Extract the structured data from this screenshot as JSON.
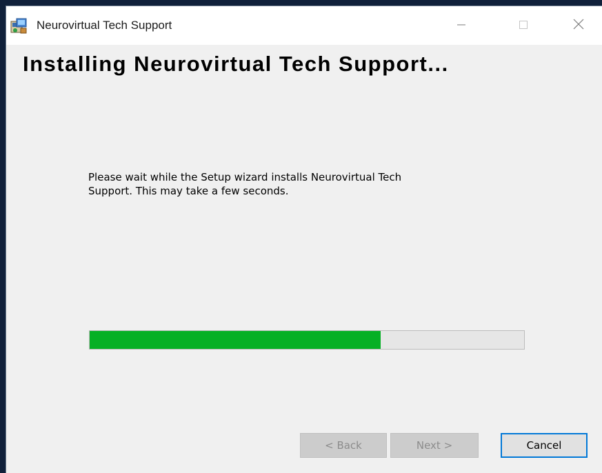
{
  "window": {
    "title": "Neurovirtual Tech Support",
    "app_icon": "installer-icon",
    "controls": {
      "minimize_icon": "minimize-icon",
      "maximize_icon": "maximize-icon",
      "close_icon": "close-icon"
    }
  },
  "header": {
    "title": "Installing Neurovirtual Tech Support..."
  },
  "body": {
    "description_line1": "Please wait while the Setup wizard installs Neurovirtual Tech",
    "description_line2": "Support. This may take a few seconds."
  },
  "progress": {
    "fraction": 0.67,
    "color": "#06b025"
  },
  "buttons": {
    "back_label": "< Back",
    "next_label": "Next >",
    "cancel_label": "Cancel"
  },
  "colors": {
    "accent": "#0078d7",
    "background": "#f0f0f0"
  }
}
